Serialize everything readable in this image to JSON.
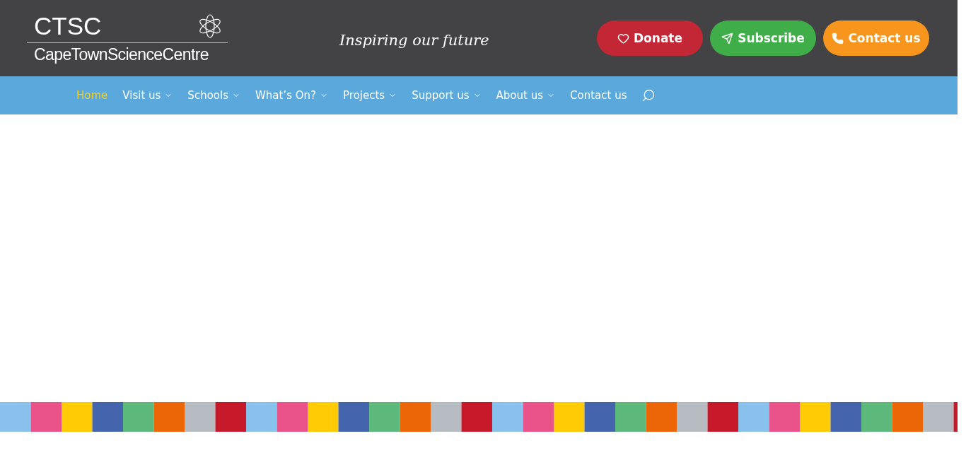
{
  "header": {
    "logo": {
      "acronym": "CTSC",
      "name": "CapeTownScienceCentre"
    },
    "tagline": "Inspiring our future",
    "buttons": [
      {
        "label": "Donate",
        "kind": "donate"
      },
      {
        "label": "Subscribe",
        "kind": "subscribe"
      },
      {
        "label": "Contact us",
        "kind": "contact"
      }
    ]
  },
  "nav": {
    "items": [
      {
        "label": "Home",
        "selected": true,
        "has_menu": false
      },
      {
        "label": "Visit us",
        "selected": false,
        "has_menu": true
      },
      {
        "label": "Schools",
        "selected": false,
        "has_menu": true
      },
      {
        "label": "What’s On?",
        "selected": false,
        "has_menu": true
      },
      {
        "label": "Projects",
        "selected": false,
        "has_menu": true
      },
      {
        "label": "Support us",
        "selected": false,
        "has_menu": true
      },
      {
        "label": "About us",
        "selected": false,
        "has_menu": true
      },
      {
        "label": "Contact us",
        "selected": false,
        "has_menu": false
      }
    ]
  }
}
